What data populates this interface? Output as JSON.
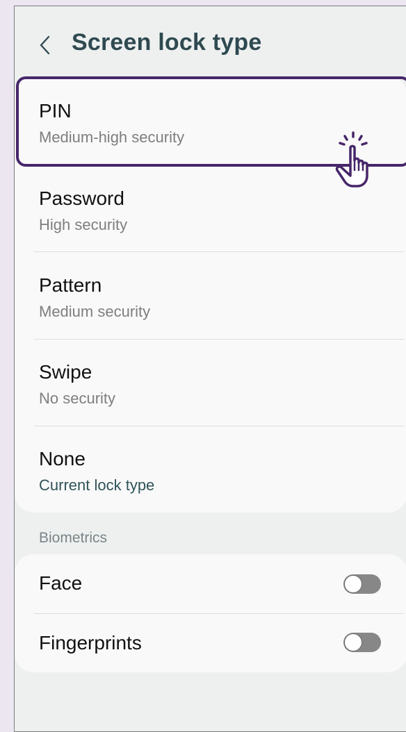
{
  "header": {
    "title": "Screen lock type",
    "back_icon": "chevron-left-icon"
  },
  "lock_types": [
    {
      "label": "PIN",
      "description": "Medium-high security"
    },
    {
      "label": "Password",
      "description": "High security"
    },
    {
      "label": "Pattern",
      "description": "Medium security"
    },
    {
      "label": "Swipe",
      "description": "No security"
    },
    {
      "label": "None",
      "description": "Current lock type"
    }
  ],
  "biometrics": {
    "section_label": "Biometrics",
    "items": [
      {
        "label": "Face",
        "enabled": false
      },
      {
        "label": "Fingerprints",
        "enabled": false
      }
    ]
  },
  "colors": {
    "highlight": "#472669",
    "title": "#2f4a50",
    "current_lock": "#2f5459",
    "toggle_off": "#878787"
  },
  "overlay": {
    "cursor_icon": "tap-hand-cursor-icon"
  }
}
